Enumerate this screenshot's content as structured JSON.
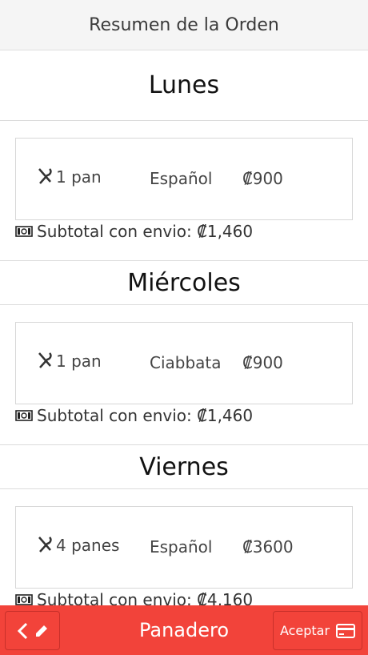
{
  "header": {
    "title": "Resumen de la Orden"
  },
  "days": [
    {
      "name": "Lunes",
      "order": {
        "qty": "1 pan",
        "bread": "Español",
        "price": "₡900"
      },
      "subtotal": "Subtotal con envio: ₡1,460"
    },
    {
      "name": "Miércoles",
      "order": {
        "qty": "1 pan",
        "bread": "Ciabbata",
        "price": "₡900"
      },
      "subtotal": "Subtotal con envio: ₡1,460"
    },
    {
      "name": "Viernes",
      "order": {
        "qty": "4 panes",
        "bread": "Español",
        "price": "₡3600"
      },
      "subtotal": "Subtotal con envio: ₡4,160"
    }
  ],
  "footer": {
    "title": "Panadero",
    "accept_label": "Aceptar",
    "back_icon": "chevron-left-icon",
    "edit_icon": "pencil-icon",
    "card_icon": "credit-card-icon"
  },
  "colors": {
    "accent": "#f2433a"
  }
}
